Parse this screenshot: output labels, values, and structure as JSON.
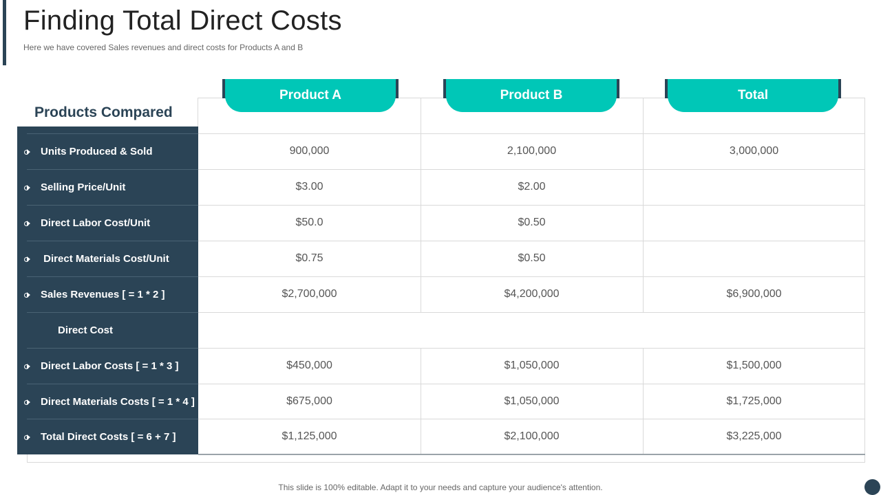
{
  "slide": {
    "title": "Finding Total Direct Costs",
    "subtitle": "Here we have covered Sales revenues and direct costs for Products A and B",
    "footer": "This slide is 100% editable. Adapt it to your needs and capture your audience's attention."
  },
  "table": {
    "corner_header": "Products Compared",
    "columns": [
      "Product A",
      "Product B",
      "Total"
    ],
    "rows": [
      {
        "label": "Units Produced & Sold",
        "values": [
          "900,000",
          "2,100,000",
          "3,000,000"
        ]
      },
      {
        "label": "Selling Price/Unit",
        "values": [
          "$3.00",
          "$2.00",
          ""
        ]
      },
      {
        "label": "Direct Labor Cost/Unit",
        "values": [
          "$50.0",
          "$0.50",
          ""
        ]
      },
      {
        "label": " Direct Materials Cost/Unit",
        "values": [
          "$0.75",
          "$0.50",
          ""
        ]
      },
      {
        "label": "Sales Revenues [ = 1 * 2 ]",
        "values": [
          "$2,700,000",
          "$4,200,000",
          "$6,900,000"
        ]
      },
      {
        "label": "Direct Cost",
        "values": [
          "",
          "",
          ""
        ]
      },
      {
        "label": "Direct Labor Costs [ = 1 * 3 ]",
        "values": [
          "$450,000",
          "$1,050,000",
          "$1,500,000"
        ]
      },
      {
        "label": "Direct Materials Costs [ = 1 * 4 ]",
        "values": [
          "$675,000",
          "$1,050,000",
          "$1,725,000"
        ]
      },
      {
        "label": "Total Direct Costs [ = 6 + 7 ]",
        "values": [
          "$1,125,000",
          "$2,100,000",
          "$3,225,000"
        ]
      }
    ]
  },
  "colors": {
    "navy": "#2b4456",
    "teal": "#00c7b7"
  }
}
